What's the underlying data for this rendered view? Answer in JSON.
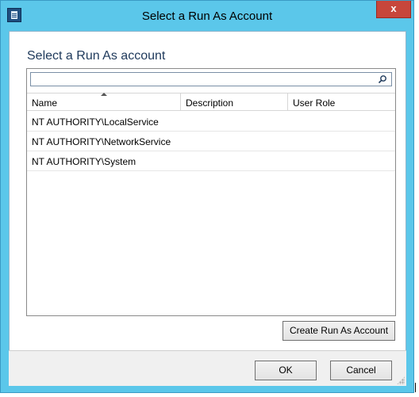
{
  "window": {
    "title": "Select a Run As Account",
    "close_label": "x"
  },
  "main": {
    "heading": "Select a Run As account",
    "search": {
      "value": "",
      "placeholder": ""
    },
    "table": {
      "columns": [
        "Name",
        "Description",
        "User Role"
      ],
      "sort_column": "Name",
      "sort_direction": "ascending",
      "rows": [
        {
          "name": "NT AUTHORITY\\LocalService",
          "description": "",
          "user_role": ""
        },
        {
          "name": "NT AUTHORITY\\NetworkService",
          "description": "",
          "user_role": ""
        },
        {
          "name": "NT AUTHORITY\\System",
          "description": "",
          "user_role": ""
        }
      ]
    },
    "create_button_label": "Create Run As Account"
  },
  "footer": {
    "ok_label": "OK",
    "cancel_label": "Cancel"
  },
  "colors": {
    "frame": "#5bc7ea",
    "close": "#c7463b",
    "heading": "#1e395b"
  },
  "icons": {
    "system_menu": "window-menu-icon",
    "search": "search-icon",
    "sort": "sort-ascending-icon",
    "resize": "resize-grip-icon"
  }
}
